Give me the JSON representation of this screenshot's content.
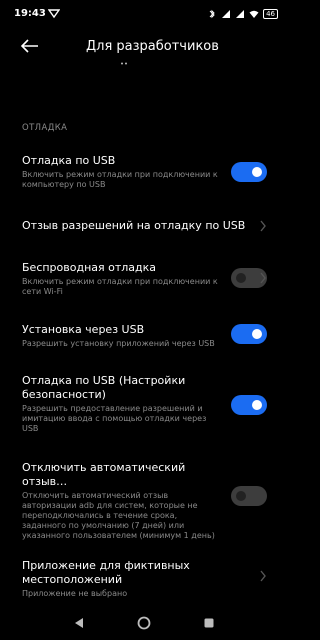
{
  "status_bar": {
    "time": "19:43",
    "battery": "46",
    "icons": [
      "bluetooth-icon",
      "signal-icon",
      "signal-icon",
      "wifi-icon",
      "battery-icon"
    ]
  },
  "header": {
    "title": "Для разработчиков",
    "back_icon": "back-arrow-icon"
  },
  "section": {
    "label": "ОТЛАДКА"
  },
  "items": [
    {
      "title": "Отладка по USB",
      "subtitle": "Включить режим отладки при подключении к компьютеру по USB",
      "control": "toggle",
      "enabled": true,
      "state": "on"
    },
    {
      "title": "Отзыв разрешений на отладку по USB",
      "subtitle": "",
      "control": "chevron",
      "enabled": true
    },
    {
      "title": "Беспроводная отладка",
      "subtitle": "Включить режим отладки при подключении к сети Wi-Fi",
      "control": "toggle",
      "enabled": false,
      "state": "off"
    },
    {
      "title": "Установка через USB",
      "subtitle": "Разрешить установку приложений через USB",
      "control": "toggle",
      "enabled": true,
      "state": "on"
    },
    {
      "title": "Отладка по USB (Настройки безопасности)",
      "subtitle": "Разрешить предоставление разрешений и имитацию ввода с помощью отладки через USB",
      "control": "toggle",
      "enabled": true,
      "state": "on"
    },
    {
      "title": "Отключить автоматический отзыв…",
      "subtitle": "Отключить автоматический отзыв авторизации adb для систем, которые не переподключались в течение срока, заданного по умолчанию (7 дней) или указанного пользователем (минимум 1 день)",
      "control": "toggle",
      "enabled": false,
      "state": "off"
    },
    {
      "title": "Приложение для фиктивных местоположений",
      "subtitle": "Приложение не выбрано",
      "control": "chevron",
      "enabled": true
    }
  ],
  "nav": {
    "buttons": [
      "back-triangle-icon",
      "home-circle-icon",
      "recents-square-icon"
    ]
  },
  "colors": {
    "background": "#000000",
    "accent": "#1b6cf2",
    "secondary_text": "#8a8a8a"
  }
}
